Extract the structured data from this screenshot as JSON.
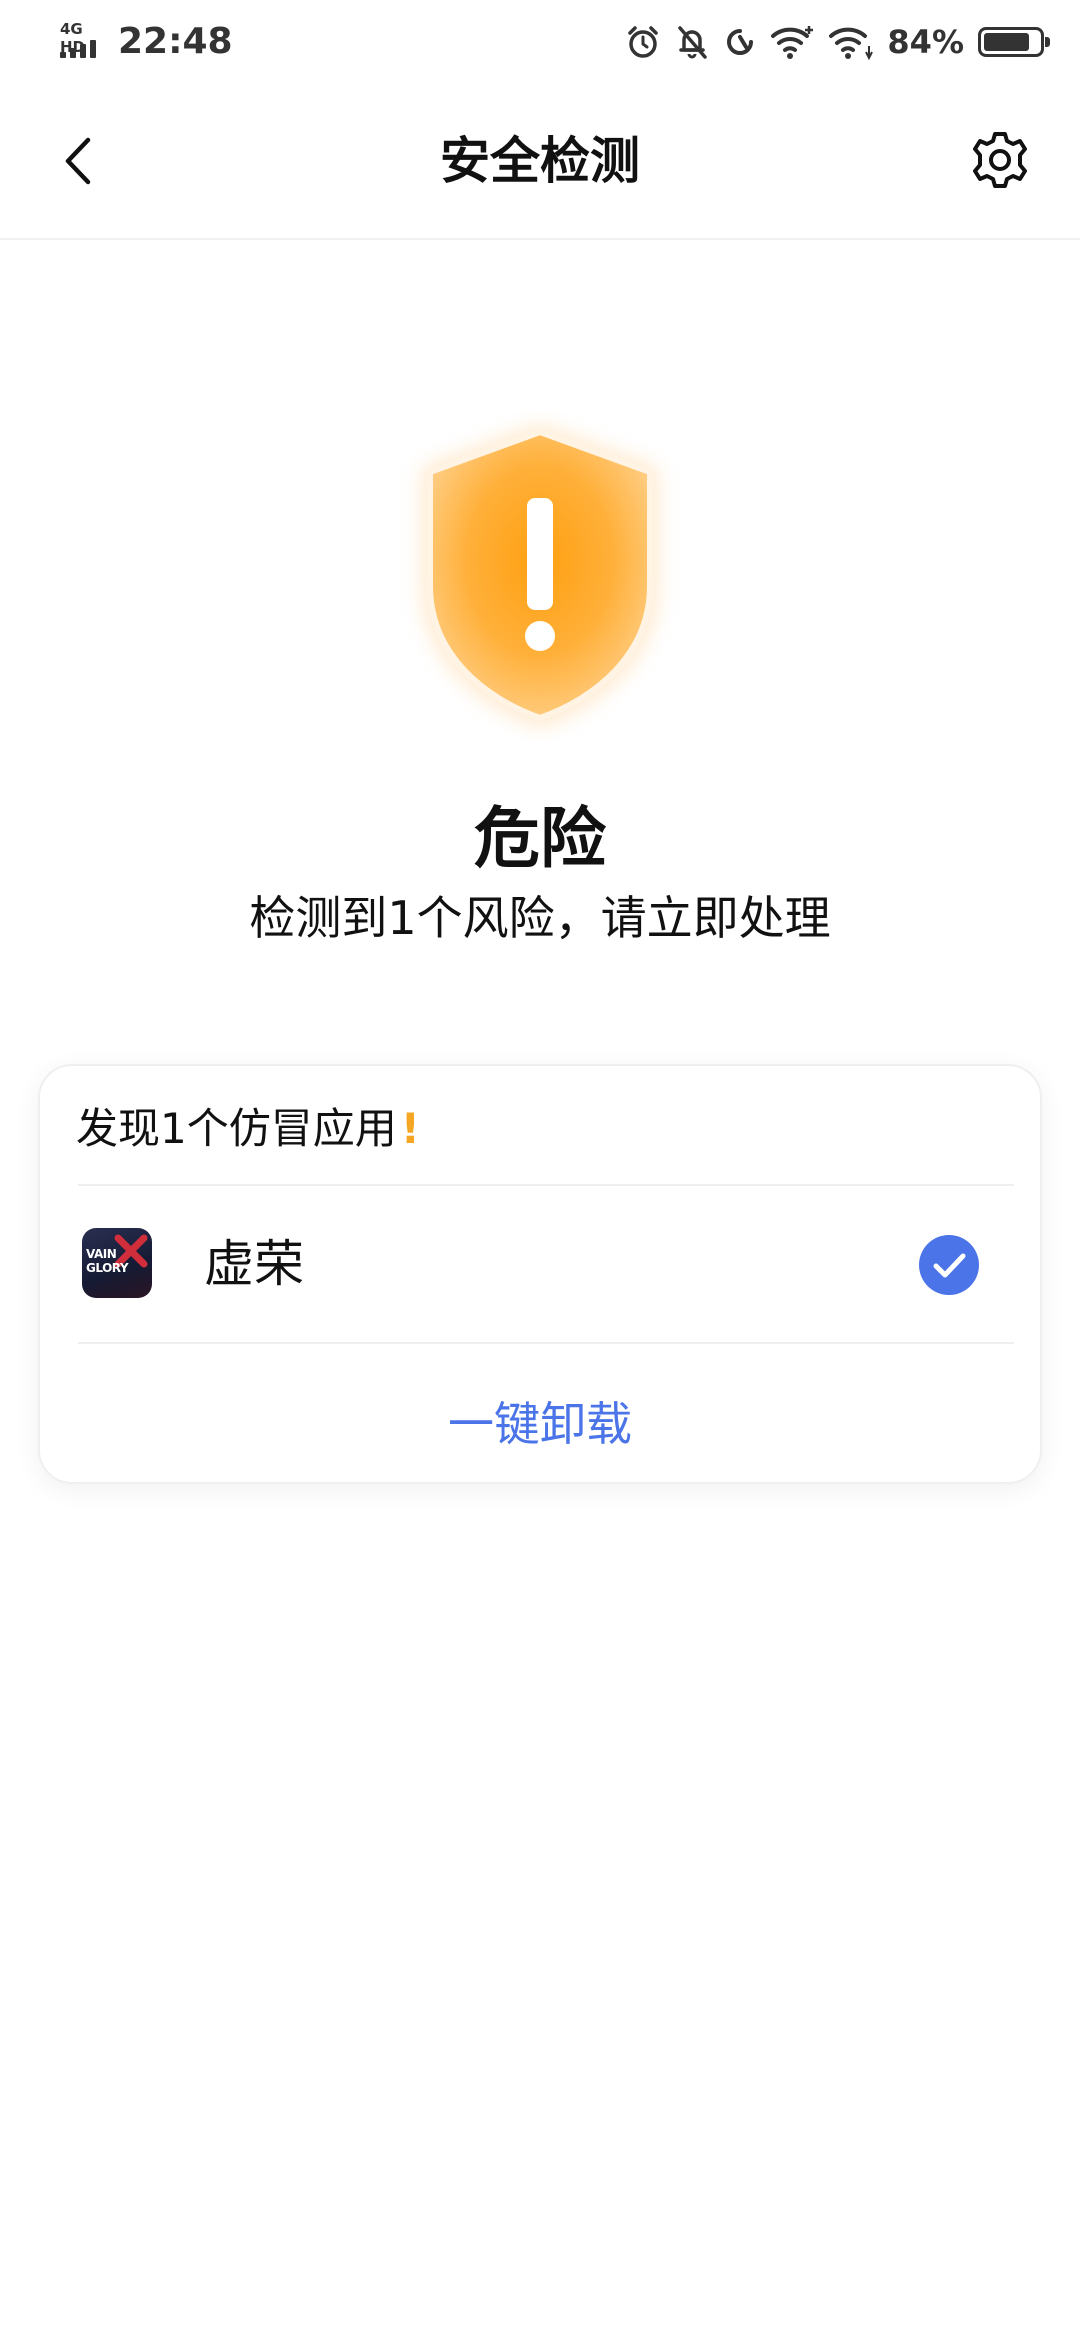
{
  "status_bar": {
    "network": "4G HD",
    "time": "22:48",
    "battery_percent": "84%",
    "battery_level": 0.84,
    "icons": [
      "alarm-icon",
      "bell-off-icon",
      "data-saver-icon",
      "wifi-plus-icon",
      "wifi-icon"
    ]
  },
  "header": {
    "title": "安全检测",
    "back_icon": "chevron-left-icon",
    "settings_icon": "gear-icon"
  },
  "hero": {
    "icon": "shield-warning-icon",
    "status": "危险",
    "message": "检测到1个风险，请立即处理",
    "shield_color": "#ffa41f"
  },
  "card": {
    "title": "发现1个仿冒应用",
    "title_mark": "!",
    "apps": [
      {
        "name": "虚荣",
        "icon": "vainglory-app-icon",
        "icon_text": [
          "VAIN",
          "GLORY"
        ],
        "selected": true
      }
    ],
    "action_label": "一键卸载"
  },
  "colors": {
    "accent": "#4a74e8",
    "warning": "#f5a623"
  }
}
